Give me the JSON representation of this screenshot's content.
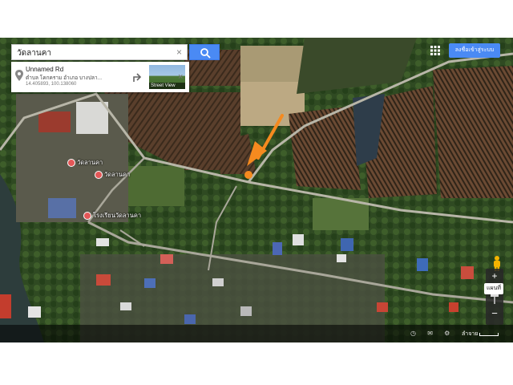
{
  "search": {
    "value": "วัดลานคา",
    "clear_glyph": "×"
  },
  "place_card": {
    "title": "Unnamed Rd",
    "subtitle": "ตำบล โคกคราม อำเภอ บางปลา...",
    "coords": "14.405893, 100.138060",
    "street_view_label": "Street View",
    "close_glyph": "×"
  },
  "header": {
    "signin_label": "ลงชื่อเข้าสู่ระบบ"
  },
  "pois": [
    {
      "label": "วัดลานคา"
    },
    {
      "label": "วัดลานคา"
    },
    {
      "label": "โรงเรียนวัดลานคา"
    }
  ],
  "controls": {
    "zoom_in": "+",
    "zoom_out": "−",
    "map_toggle": "แผนที่"
  },
  "footer": {
    "icons": "◷ ✉ ⚙",
    "scale_label": "ลำจาย"
  },
  "colors": {
    "accent": "#4a8af4",
    "arrow": "#f58a1f",
    "poi": "#e35757"
  },
  "icons": [
    "search-icon",
    "pin-icon",
    "directions-icon",
    "apps-icon",
    "pegman-icon",
    "arrow-icon"
  ]
}
